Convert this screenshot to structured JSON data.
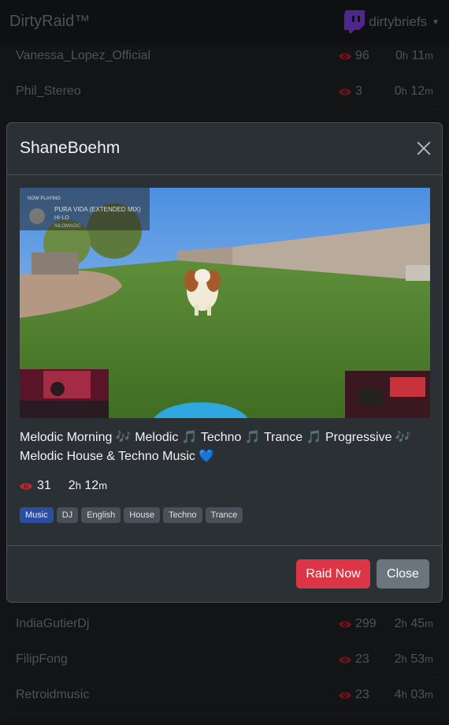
{
  "header": {
    "brand": "DirtyRaid™",
    "username": "dirtybriefs"
  },
  "streams_top": [
    {
      "name": "Vanessa_Lopez_Official",
      "viewers": "96",
      "hours": "0",
      "minutes": "11"
    },
    {
      "name": "Phil_Stereo",
      "viewers": "3",
      "hours": "0",
      "minutes": "12"
    }
  ],
  "streams_bottom": [
    {
      "name": "IndiaGutierDj",
      "viewers": "299",
      "hours": "2",
      "minutes": "45"
    },
    {
      "name": "FilipFong",
      "viewers": "23",
      "hours": "2",
      "minutes": "53"
    },
    {
      "name": "Retroidmusic",
      "viewers": "23",
      "hours": "4",
      "minutes": "03"
    }
  ],
  "units": {
    "h": "h",
    "m": "m"
  },
  "modal": {
    "title": "ShaneBoehm",
    "description": "Melodic Morning 🎶 Melodic 🎵 Techno 🎵 Trance 🎵 Progressive 🎶 Melodic House & Techno Music 💙",
    "viewers": "31",
    "hours": "2",
    "minutes": "12",
    "tags": [
      "Music",
      "DJ",
      "English",
      "House",
      "Techno",
      "Trance"
    ],
    "raid_label": "Raid Now",
    "close_label": "Close",
    "thumbnail": {
      "now_playing_label": "NOW PLAYING",
      "track_title": "PURA VIDA (EXTENDED MIX)",
      "track_artist": "HI-LO",
      "track_label": "NILOMAGIC"
    }
  },
  "colors": {
    "accent_twitch": "#9146ff",
    "eye_red": "#c8232c",
    "raid_button": "#dc3545",
    "close_button": "#6c757d",
    "tag_primary": "#2b4ea0"
  }
}
